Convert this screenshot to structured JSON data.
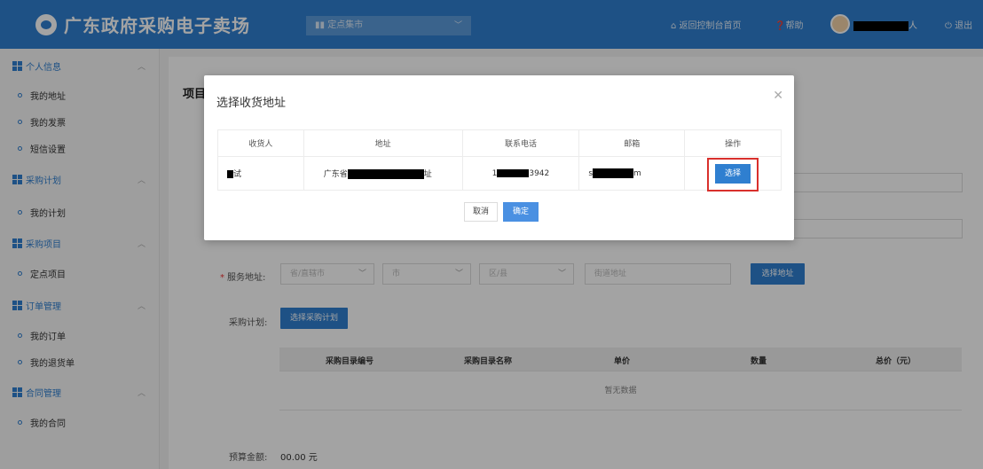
{
  "header": {
    "app_title": "广东政府采购电子卖场",
    "market_select": "定点集市",
    "home_link": "返回控制台首页",
    "help_link": "帮助",
    "user_name_suffix": "人",
    "logout_link": "退出",
    "brand_color": "#2f7fd0"
  },
  "sidebar": {
    "groups": [
      {
        "label": "个人信息",
        "items": [
          "我的地址",
          "我的发票",
          "短信设置"
        ]
      },
      {
        "label": "采购计划",
        "items": [
          "我的计划"
        ]
      },
      {
        "label": "采购项目",
        "items": [
          "定点项目"
        ]
      },
      {
        "label": "订单管理",
        "items": [
          "我的订单",
          "我的退货单"
        ]
      },
      {
        "label": "合同管理",
        "items": [
          "我的合同"
        ]
      }
    ]
  },
  "main": {
    "page_title_partial": "项目",
    "service_address_label": "服务地址:",
    "province_placeholder": "省/直辖市",
    "city_placeholder": "市",
    "district_placeholder": "区/县",
    "street_placeholder": "街道地址",
    "select_address_btn": "选择地址",
    "plan_label": "采购计划:",
    "select_plan_btn": "选择采购计划",
    "table_headers": [
      "采购目录编号",
      "采购目录名称",
      "单价",
      "数量",
      "总价（元）"
    ],
    "empty_text": "暂无数据",
    "budget_label": "预算金额:",
    "budget_value": "00.00 元"
  },
  "modal": {
    "title": "选择收货地址",
    "columns": [
      "收货人",
      "地址",
      "联系电话",
      "邮箱",
      "操作"
    ],
    "row": {
      "receiver_suffix": "试",
      "address_prefix": "广东省",
      "address_suffix": "址",
      "phone_prefix": "1",
      "phone_suffix": "3942",
      "email_prefix": "s",
      "email_suffix": "m",
      "action": "选择"
    },
    "cancel_label": "取消",
    "ok_label": "确定"
  }
}
